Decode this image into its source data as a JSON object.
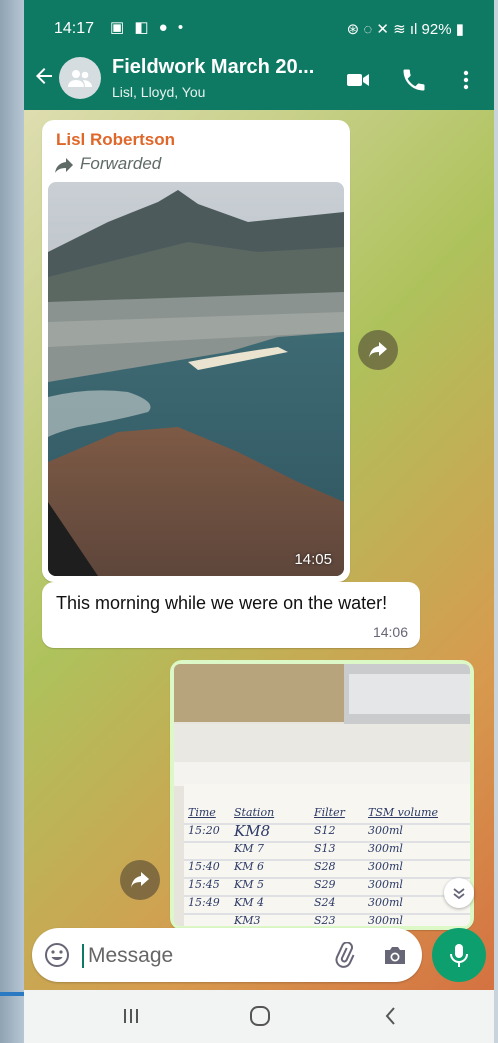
{
  "status_bar": {
    "time": "14:17",
    "battery": "92%"
  },
  "app_bar": {
    "title": "Fieldwork March 20...",
    "subtitle": "Lisl, Lloyd, You"
  },
  "messages": [
    {
      "direction": "incoming",
      "sender": "Lisl Robertson",
      "forwarded_label": "Forwarded",
      "image_time": "14:05"
    },
    {
      "direction": "incoming",
      "text": "This morning while we were on the water!",
      "time": "14:06"
    },
    {
      "direction": "outgoing",
      "image_text": {
        "headers": [
          "Time",
          "Station",
          "Filter",
          "TSM volume"
        ],
        "rows": [
          [
            "15:20",
            "KM8",
            "S12",
            "300ml"
          ],
          [
            "",
            "KM 7",
            "S13",
            "300ml"
          ],
          [
            "15:40",
            "KM 6",
            "S28",
            "300ml"
          ],
          [
            "15:45",
            "KM 5",
            "S29",
            "300ml"
          ],
          [
            "15:49",
            "KM 4",
            "S24",
            "300ml"
          ],
          [
            "",
            "KM3",
            "S23",
            "300ml"
          ]
        ]
      }
    }
  ],
  "composer": {
    "placeholder": "Message"
  },
  "colors": {
    "header": "#0f7a63",
    "sender_name": "#e0672a",
    "outgoing_bubble": "#dcf8c6",
    "mic_button": "#0e9f6e"
  },
  "icons": [
    "back-arrow-icon",
    "group-avatar-icon",
    "video-call-icon",
    "voice-call-icon",
    "more-menu-icon",
    "forward-icon",
    "emoji-icon",
    "attach-icon",
    "camera-icon",
    "mic-icon",
    "scroll-down-icon",
    "recent-apps-icon",
    "home-icon",
    "back-icon"
  ]
}
